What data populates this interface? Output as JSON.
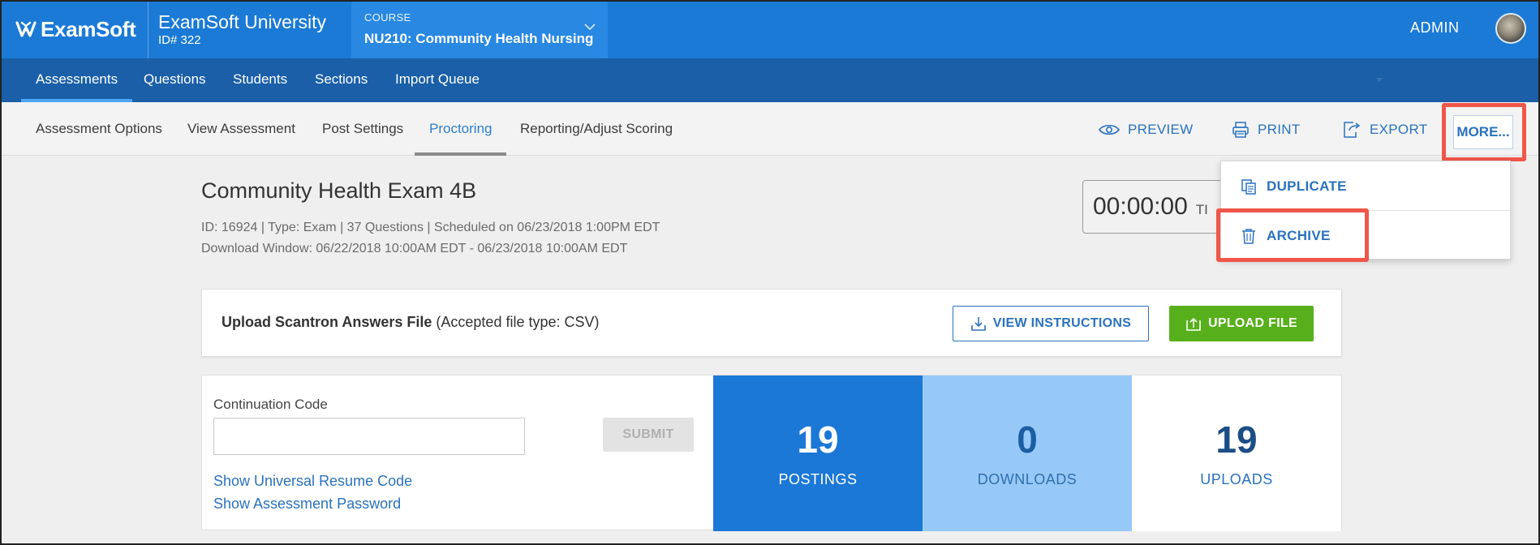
{
  "header": {
    "logo_text": "ExamSoft",
    "university_name": "ExamSoft University",
    "university_id": "ID# 322",
    "course_caption": "COURSE",
    "course_name": "NU210: Community Health Nursing",
    "user_label": "ADMIN",
    "brand_color": "#1b7ad6"
  },
  "main_nav": {
    "items": [
      {
        "label": "Assessments",
        "active": true
      },
      {
        "label": "Questions"
      },
      {
        "label": "Students"
      },
      {
        "label": "Sections"
      },
      {
        "label": "Import Queue"
      }
    ]
  },
  "sub_nav": {
    "items": [
      {
        "label": "Assessment Options"
      },
      {
        "label": "View Assessment"
      },
      {
        "label": "Post Settings"
      },
      {
        "label": "Proctoring",
        "active": true
      },
      {
        "label": "Reporting/Adjust Scoring"
      }
    ],
    "actions": {
      "preview": {
        "label": "PREVIEW",
        "icon": "eye-icon"
      },
      "print": {
        "label": "PRINT",
        "icon": "printer-icon"
      },
      "export": {
        "label": "EXPORT",
        "icon": "export-icon"
      },
      "more": {
        "label": "MORE..."
      }
    }
  },
  "more_menu": {
    "items": [
      {
        "label": "DUPLICATE",
        "icon": "duplicate-icon"
      },
      {
        "label": "ARCHIVE",
        "icon": "trash-icon"
      }
    ]
  },
  "exam": {
    "title": "Community Health Exam 4B",
    "meta_line1": "ID: 16924 | Type: Exam | 37 Questions | Scheduled on 06/23/2018 1:00PM EDT",
    "meta_line2": "Download Window: 06/22/2018 10:00AM EDT - 06/23/2018 10:00AM EDT",
    "timer_value": "00:00:00",
    "timer_label": "TI"
  },
  "upload": {
    "title": "Upload Scantron Answers File",
    "subtitle": "(Accepted file type: CSV)",
    "view_instructions_label": "VIEW INSTRUCTIONS",
    "upload_file_label": "UPLOAD FILE"
  },
  "continuation": {
    "label": "Continuation Code",
    "value": "",
    "placeholder": "",
    "submit_label": "SUBMIT",
    "link_resume": "Show Universal Resume Code",
    "link_password": "Show Assessment Password"
  },
  "stats": {
    "postings": {
      "value": "19",
      "label": "POSTINGS",
      "bg": "#1c78d6"
    },
    "downloads": {
      "value": "0",
      "label": "DOWNLOADS",
      "bg": "#97c9f8"
    },
    "uploads": {
      "value": "19",
      "label": "UPLOADS",
      "bg": "#ffffff"
    }
  },
  "colors": {
    "accent": "#2a72bf",
    "highlight": "#f0564a",
    "success": "#57b01b"
  }
}
